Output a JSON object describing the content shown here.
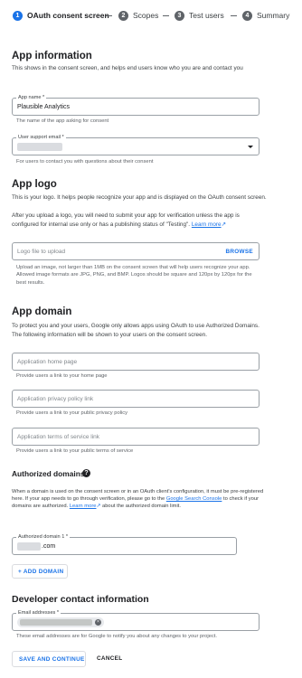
{
  "stepper": {
    "steps": [
      {
        "number": "1",
        "label": "OAuth consent screen"
      },
      {
        "number": "2",
        "label": "Scopes"
      },
      {
        "number": "3",
        "label": "Test users"
      },
      {
        "number": "4",
        "label": "Summary"
      }
    ]
  },
  "app_information": {
    "title": "App information",
    "description": "This shows in the consent screen, and helps end users know who you are and contact you",
    "app_name": {
      "label": "App name *",
      "value": "Plausible Analytics",
      "hint": "The name of the app asking for consent"
    },
    "support_email": {
      "label": "User support email *",
      "hint": "For users to contact you with questions about their consent"
    }
  },
  "app_logo": {
    "title": "App logo",
    "description_1": "This is your logo. It helps people recognize your app and is displayed on the OAuth consent screen.",
    "description_2": "After you upload a logo, you will need to submit your app for verification unless the app is configured for internal use only or has a publishing status of \"Testing\".",
    "learn_more": "Learn more",
    "upload_placeholder": "Logo file to upload",
    "browse_label": "BROWSE",
    "hint": "Upload an image, not larger than 1MB on the consent screen that will help users recognize your app. Allowed image formats are JPG, PNG, and BMP. Logos should be square and 120px by 120px for the best results."
  },
  "app_domain": {
    "title": "App domain",
    "description": "To protect you and your users, Google only allows apps using OAuth to use Authorized Domains. The following information will be shown to your users on the consent screen.",
    "home_page": {
      "placeholder": "Application home page",
      "hint": "Provide users a link to your home page"
    },
    "privacy_policy": {
      "placeholder": "Application privacy policy link",
      "hint": "Provide users a link to your public privacy policy"
    },
    "terms_of_service": {
      "placeholder": "Application terms of service link",
      "hint": "Provide users a link to your public terms of service"
    }
  },
  "authorized_domains": {
    "title": "Authorized domains",
    "text_1": "When a domain is used on the consent screen or in an OAuth client's configuration, it must be pre-registered here. If your app needs to go through verification, please go to the",
    "search_console_link": "Google Search Console",
    "text_2": "to check if your domains are authorized.",
    "learn_more": "Learn more",
    "text_3": "about the authorized domain limit.",
    "domain_1": {
      "label": "Authorized domain 1 *",
      "value": ".com"
    },
    "add_domain_label": "+ ADD DOMAIN"
  },
  "developer_contact": {
    "title": "Developer contact information",
    "email_label": "Email addresses *",
    "hint": "These email addresses are for Google to notify you about any changes to your project."
  },
  "actions": {
    "save_label": "SAVE AND CONTINUE",
    "cancel_label": "CANCEL"
  },
  "colors": {
    "accent": "#1a73e8",
    "text": "#202124",
    "muted": "#5f6368",
    "border": "#9aa0a6"
  }
}
